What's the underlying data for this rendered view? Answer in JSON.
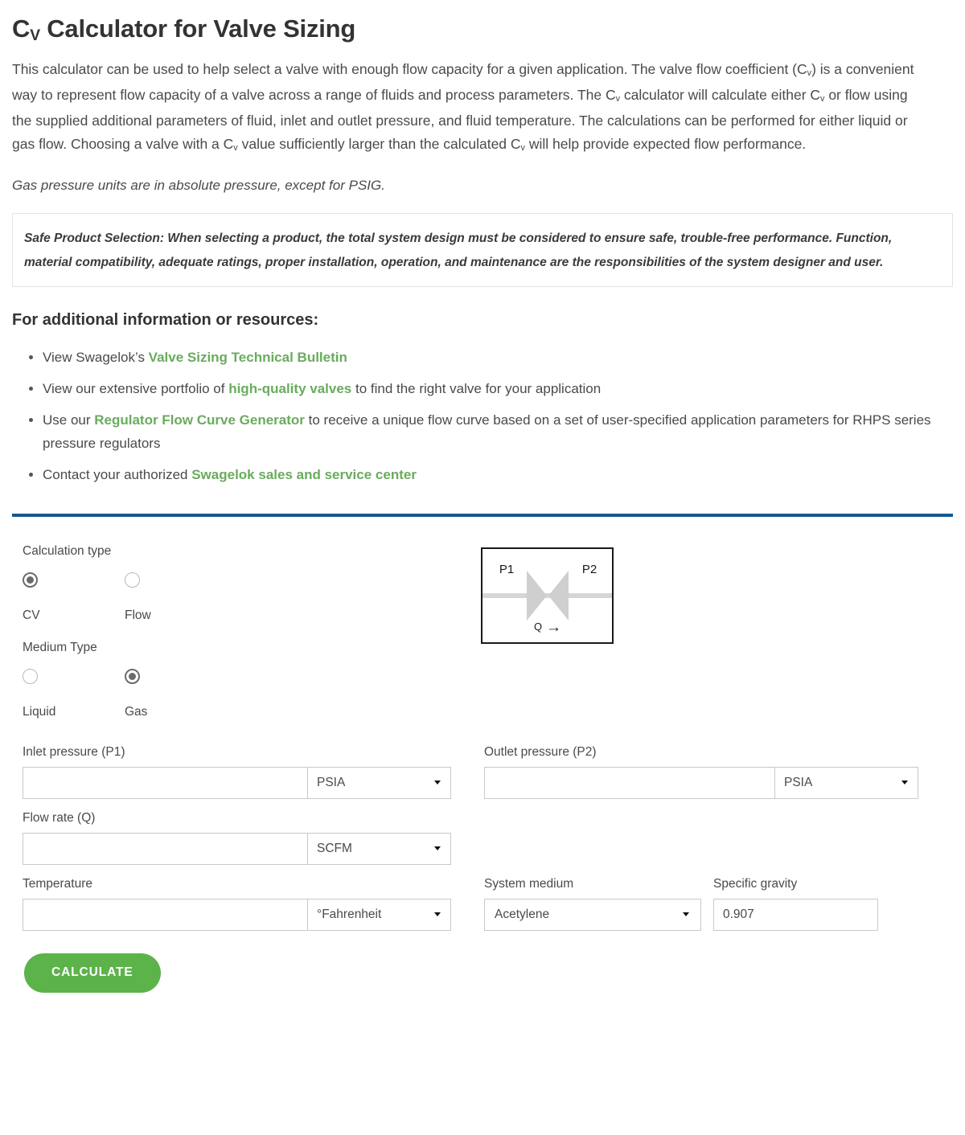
{
  "header": {
    "title_pre": "C",
    "title_sub": "V",
    "title_post": " Calculator for Valve Sizing"
  },
  "intro": {
    "p1_a": "This calculator can be used to help select a valve with enough flow capacity for a given application. The valve flow coefficient (C",
    "p1_sub1": "v",
    "p1_b": ") is a convenient way to represent flow capacity of a valve across a range of fluids and process parameters. The C",
    "p1_sub2": "v",
    "p1_c": " calculator will calculate either C",
    "p1_sub3": "v",
    "p1_d": " or flow using the supplied additional parameters of fluid, inlet and outlet pressure, and fluid temperature. The calculations can be performed for either liquid or gas flow. Choosing a valve with a C",
    "p1_sub4": "v",
    "p1_e": " value sufficiently larger than the calculated C",
    "p1_sub5": "v",
    "p1_f": " will help provide expected flow performance.",
    "note": "Gas pressure units are in absolute pressure, except for PSIG."
  },
  "safe_box": {
    "lead": "Safe Product Selection:",
    "body": " When selecting a product, the total system design must be considered to ensure safe, trouble-free performance. Function, material compatibility, adequate ratings, proper installation, operation, and maintenance are the responsibilities of the system designer and user."
  },
  "resources": {
    "title": "For additional information or resources:",
    "items": [
      {
        "pre": "View Swagelok’s ",
        "link": "Valve Sizing Technical Bulletin",
        "post": ""
      },
      {
        "pre": "View our extensive portfolio of ",
        "link": "high-quality valves",
        "post": " to find the right valve for your application"
      },
      {
        "pre": "Use our ",
        "link": "Regulator Flow Curve Generator",
        "post": " to receive a unique flow curve based on a set of user-specified application parameters for RHPS series pressure regulators"
      },
      {
        "pre": "Contact your authorized ",
        "link": "Swagelok sales and service center",
        "post": ""
      }
    ]
  },
  "form": {
    "calc_type": {
      "label": "Calculation type",
      "options": [
        {
          "label": "CV",
          "selected": true
        },
        {
          "label": "Flow",
          "selected": false
        }
      ]
    },
    "medium_type": {
      "label": "Medium Type",
      "options": [
        {
          "label": "Liquid",
          "selected": false
        },
        {
          "label": "Gas",
          "selected": true
        }
      ]
    },
    "inlet_pressure": {
      "label": "Inlet pressure (P1)",
      "value": "",
      "placeholder": "",
      "unit": "PSIA"
    },
    "outlet_pressure": {
      "label": "Outlet pressure (P2)",
      "value": "",
      "placeholder": "",
      "unit": "PSIA"
    },
    "flow_rate": {
      "label": "Flow rate (Q)",
      "value": "",
      "placeholder": "",
      "unit": "SCFM"
    },
    "temperature": {
      "label": "Temperature",
      "value": "",
      "placeholder": "",
      "unit": "°Fahrenheit"
    },
    "system_medium": {
      "label": "System medium",
      "value": "Acetylene"
    },
    "specific_gravity": {
      "label": "Specific gravity",
      "value": "0.907"
    },
    "submit_label": "CALCULATE"
  },
  "diagram": {
    "p1": "P1",
    "p2": "P2",
    "q": "Q",
    "arrow": "→"
  },
  "colors": {
    "link_green": "#6aab5e",
    "button_green": "#5cb34a",
    "divider_blue": "#15588f",
    "body_text": "#4a4a4a"
  }
}
